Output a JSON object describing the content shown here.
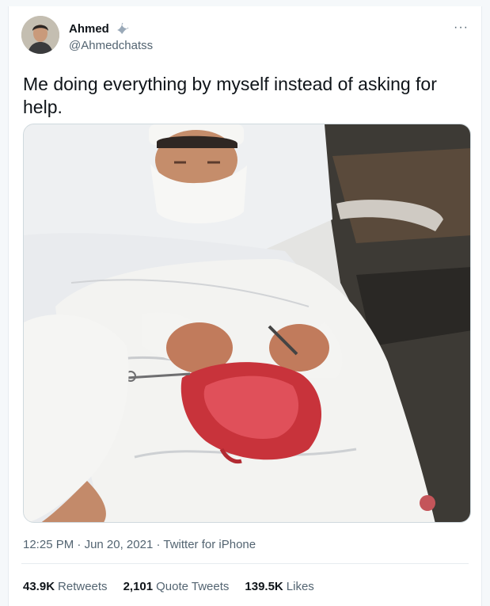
{
  "tweet": {
    "author_name": "Ahmed",
    "author_handle": "@Ahmedchatss",
    "more_icon": "···",
    "text": "Me doing everything by myself instead of asking for help.",
    "time": "12:25 PM",
    "separator": " · ",
    "date": "Jun 20, 2021",
    "source": "Twitter for iPhone",
    "stats": {
      "retweets_count": "43.9K",
      "retweets_label": "Retweets",
      "quotes_count": "2,101",
      "quotes_label": "Quote Tweets",
      "likes_count": "139.5K",
      "likes_label": "Likes"
    }
  },
  "icons": {
    "name_badge": "dove-icon",
    "more": "more-options-icon"
  },
  "colors": {
    "text_primary": "#0f1419",
    "text_secondary": "#536471",
    "border": "#e6ecf0"
  }
}
